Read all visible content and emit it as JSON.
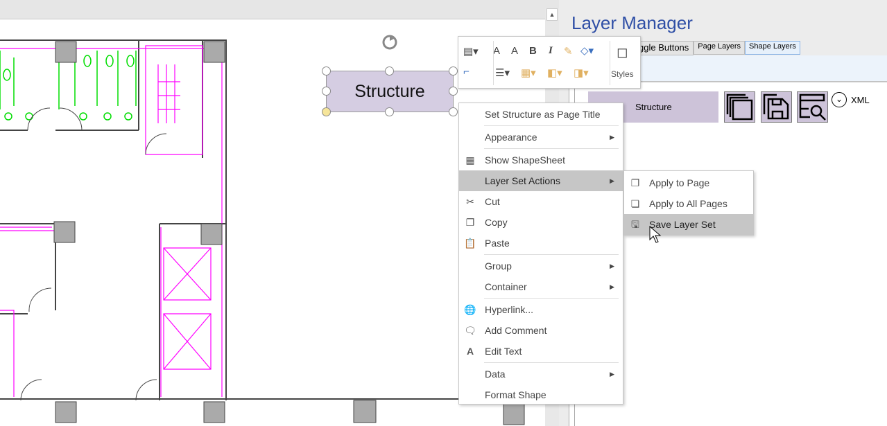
{
  "panel": {
    "title": "Layer Manager",
    "tabs": [
      {
        "label": "ggle Buttons"
      },
      {
        "label": "Page Layers"
      },
      {
        "label": "Shape Layers"
      }
    ],
    "layer_name": "Structure",
    "xml_label": "XML",
    "icons": [
      "apply-layers-icon",
      "save-layer-icon",
      "search-layer-icon"
    ]
  },
  "shape": {
    "text": "Structure"
  },
  "mini_toolbar": {
    "styles_label": "Styles"
  },
  "context_menu": {
    "items": [
      {
        "label": "Set Structure as Page Title"
      },
      {
        "label": "Appearance",
        "submenu": true
      },
      {
        "label": "Show ShapeSheet",
        "icon": "shapesheet-icon"
      },
      {
        "label": "Layer Set Actions",
        "submenu": true,
        "highlighted": true
      },
      {
        "label": "Cut",
        "icon": "scissors-icon"
      },
      {
        "label": "Copy",
        "icon": "copy-icon"
      },
      {
        "label": "Paste",
        "icon": "paste-icon"
      },
      {
        "label": "Group",
        "submenu": true
      },
      {
        "label": "Container",
        "submenu": true
      },
      {
        "label": "Hyperlink...",
        "icon": "hyperlink-icon"
      },
      {
        "label": "Add Comment",
        "icon": "comment-icon"
      },
      {
        "label": "Edit Text",
        "icon": "text-icon"
      },
      {
        "label": "Data",
        "submenu": true
      },
      {
        "label": "Format Shape"
      }
    ]
  },
  "submenu": {
    "items": [
      {
        "label": "Apply to Page"
      },
      {
        "label": "Apply to All Pages"
      },
      {
        "label": "Save Layer Set",
        "highlighted": true
      }
    ]
  },
  "colors": {
    "accent": "#2f4fa6",
    "layer_fill": "#cdc3d9",
    "plan_magenta": "#ff00ff",
    "plan_green": "#00cc00"
  }
}
